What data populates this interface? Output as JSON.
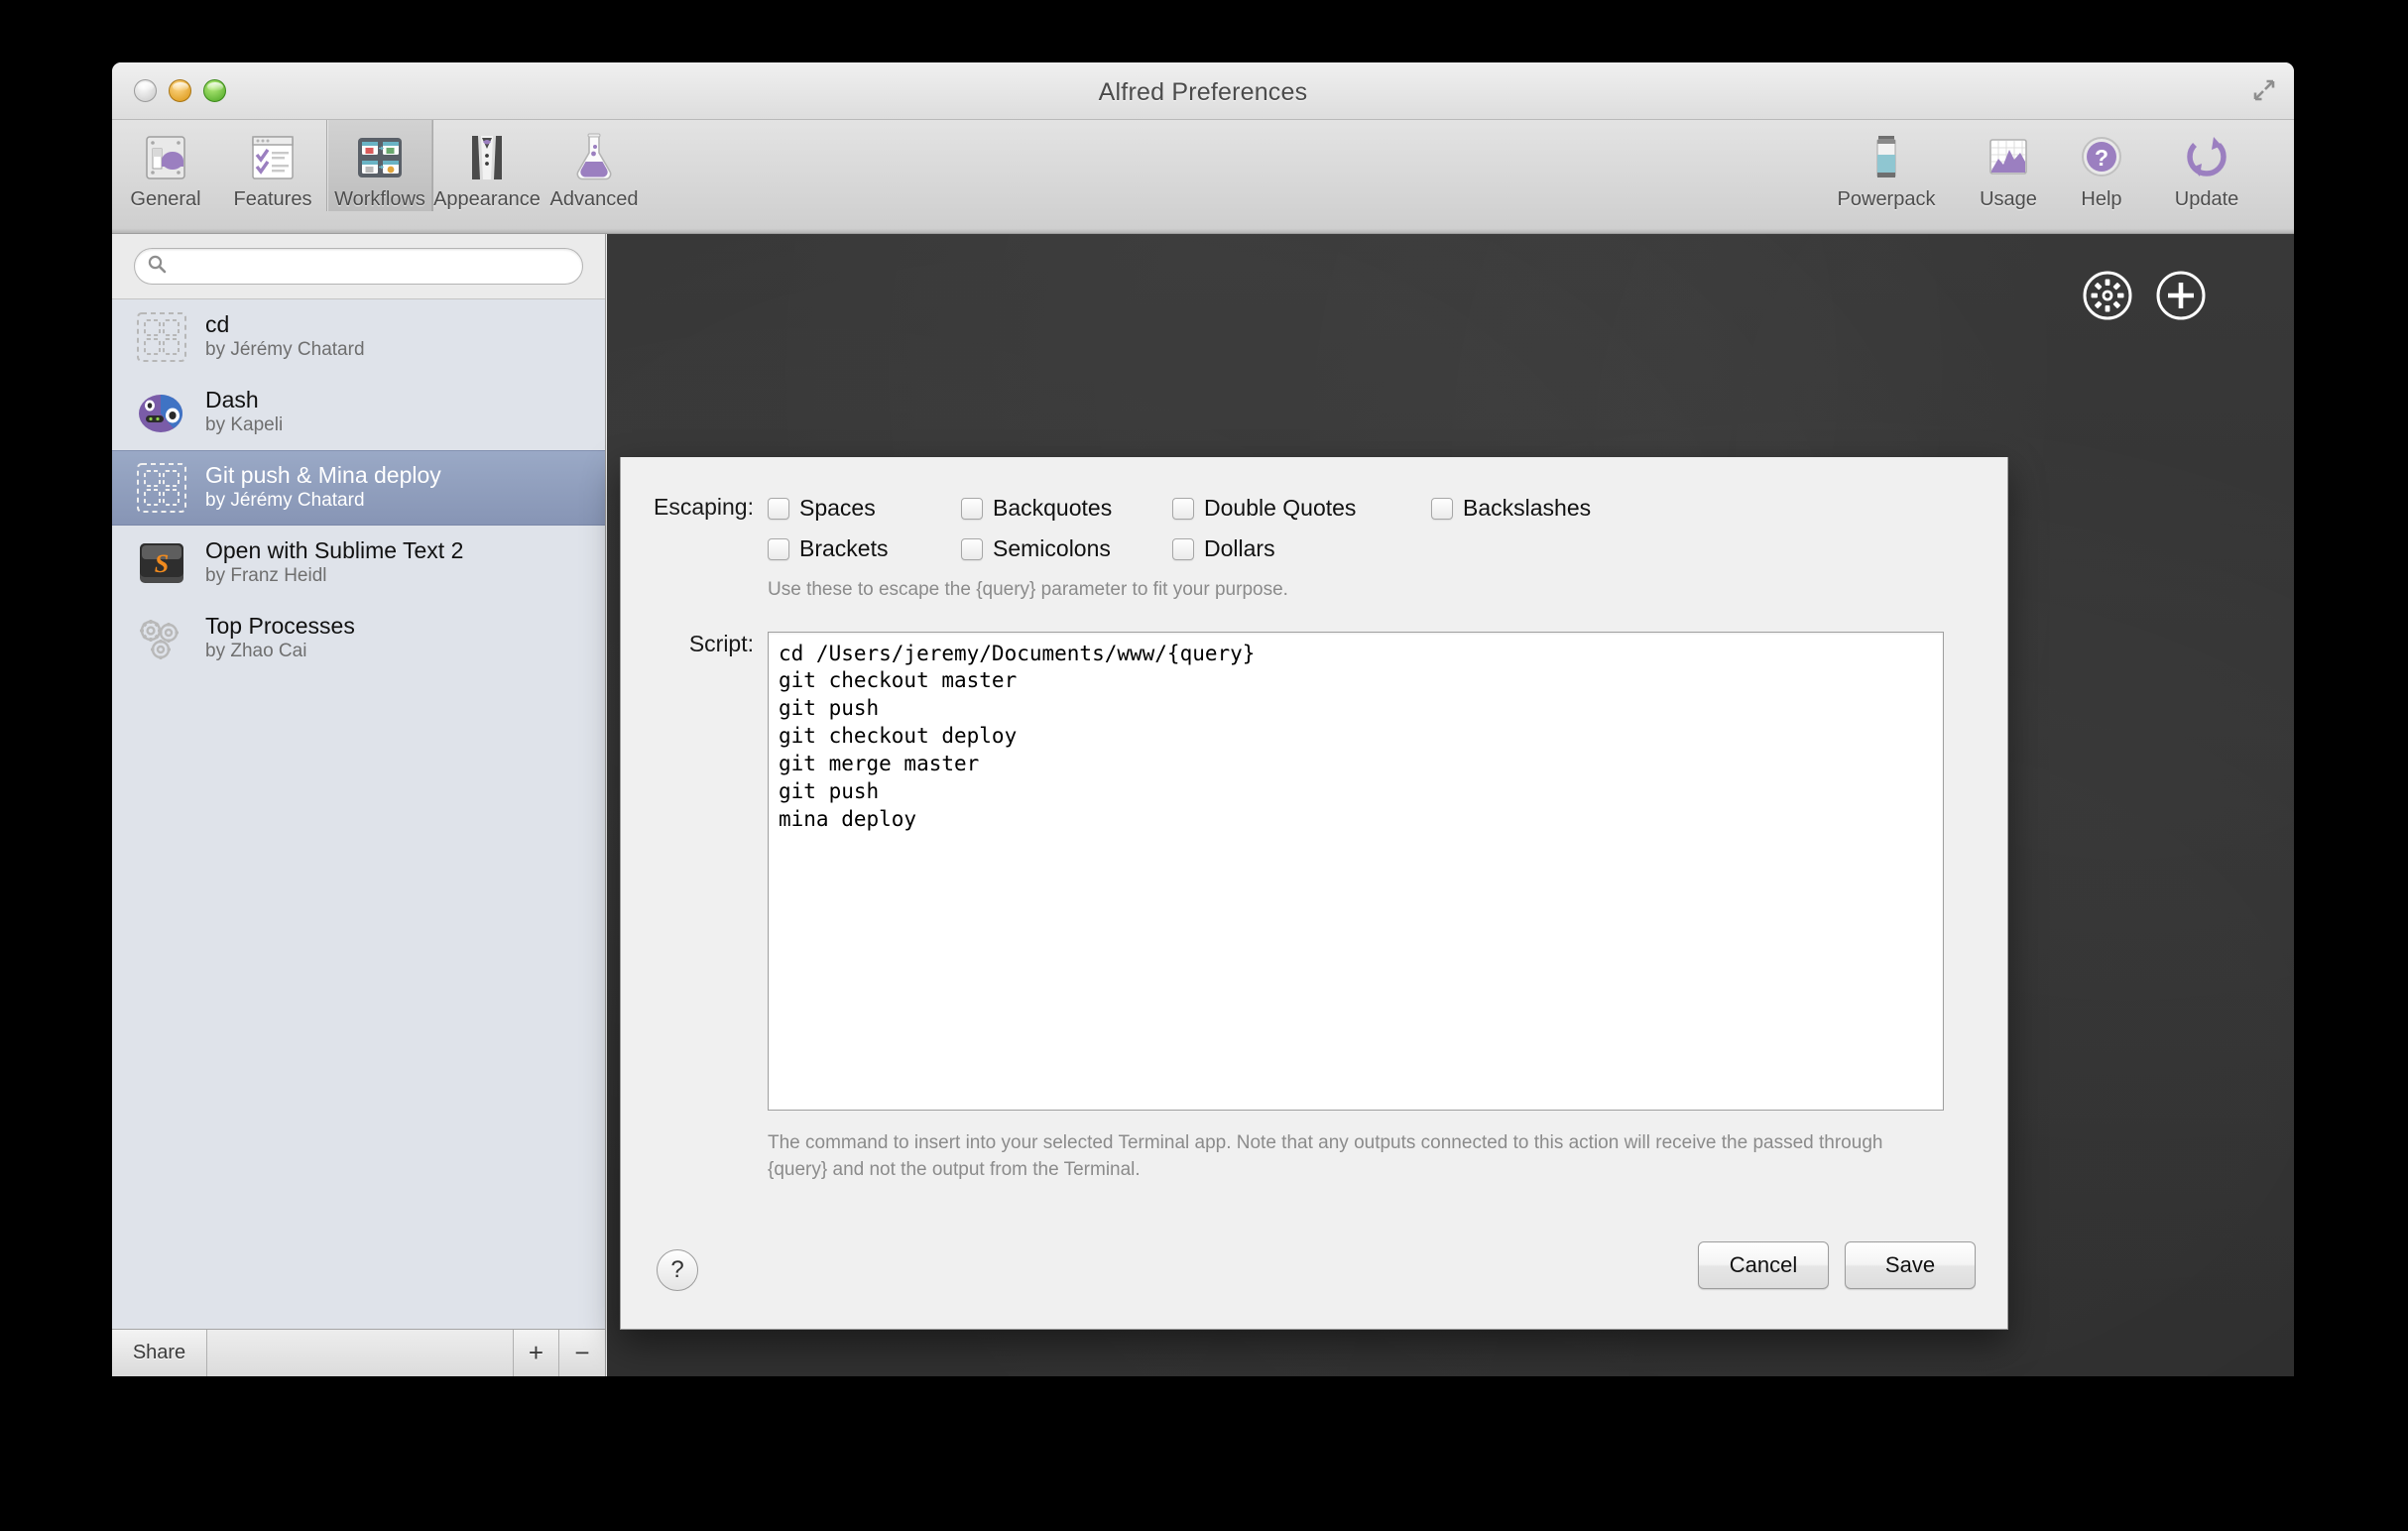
{
  "window": {
    "title": "Alfred Preferences",
    "traffic_lights": [
      "close-button",
      "minimize-button",
      "zoom-button"
    ],
    "fullscreen_icon": "fullscreen-arrows-icon"
  },
  "toolbar": {
    "left_items": [
      {
        "label": "General",
        "icon": "general-icon",
        "selected": false
      },
      {
        "label": "Features",
        "icon": "features-icon",
        "selected": false
      },
      {
        "label": "Workflows",
        "icon": "workflows-icon",
        "selected": true
      },
      {
        "label": "Appearance",
        "icon": "appearance-icon",
        "selected": false
      },
      {
        "label": "Advanced",
        "icon": "advanced-icon",
        "selected": false
      }
    ],
    "right_items": [
      {
        "label": "Powerpack",
        "icon": "battery-icon"
      },
      {
        "label": "Usage",
        "icon": "chart-icon"
      },
      {
        "label": "Help",
        "icon": "question-circle-icon"
      },
      {
        "label": "Update",
        "icon": "refresh-icon"
      }
    ]
  },
  "sidebar": {
    "search": {
      "value": "",
      "placeholder": "",
      "icon": "search-icon"
    },
    "workflows": [
      {
        "name": "cd",
        "author": "by Jérémy Chatard",
        "icon": "placeholder-grid-icon",
        "selected": false
      },
      {
        "name": "Dash",
        "author": "by Kapeli",
        "icon": "dash-app-icon",
        "selected": false
      },
      {
        "name": "Git push & Mina deploy",
        "author": "by Jérémy Chatard",
        "icon": "placeholder-grid-icon",
        "selected": true
      },
      {
        "name": "Open with Sublime Text 2",
        "author": "by Franz Heidl",
        "icon": "sublime-text-icon",
        "selected": false
      },
      {
        "name": "Top Processes",
        "author": "by Zhao Cai",
        "icon": "gears-icon",
        "selected": false
      }
    ],
    "footer": {
      "share_label": "Share",
      "add_label": "+",
      "remove_label": "−"
    }
  },
  "canvas": {
    "tools": [
      {
        "name": "workflow-settings-gear",
        "icon": "gear-circle-icon"
      },
      {
        "name": "add-object",
        "icon": "plus-circle-icon"
      }
    ]
  },
  "sheet": {
    "escaping_label": "Escaping:",
    "escaping_options": [
      {
        "label": "Spaces",
        "checked": false
      },
      {
        "label": "Backquotes",
        "checked": false
      },
      {
        "label": "Double Quotes",
        "checked": false
      },
      {
        "label": "Backslashes",
        "checked": false
      },
      {
        "label": "Brackets",
        "checked": false
      },
      {
        "label": "Semicolons",
        "checked": false
      },
      {
        "label": "Dollars",
        "checked": false
      }
    ],
    "escaping_hint": "Use these to escape the {query} parameter to fit your purpose.",
    "script_label": "Script:",
    "script_value": "cd /Users/jeremy/Documents/www/{query}\ngit checkout master\ngit push\ngit checkout deploy\ngit merge master\ngit push\nmina deploy",
    "script_hint": "The command to insert into your selected Terminal app. Note that any outputs connected to this action will receive the passed through {query} and not the output from the Terminal.",
    "help_label": "?",
    "cancel_label": "Cancel",
    "save_label": "Save"
  },
  "colors": {
    "selection_blue": "#8795b5",
    "sidebar_bg": "#dfe3ea",
    "canvas_dark": "#2f2f2f",
    "accent_purple": "#9b7fc0"
  }
}
